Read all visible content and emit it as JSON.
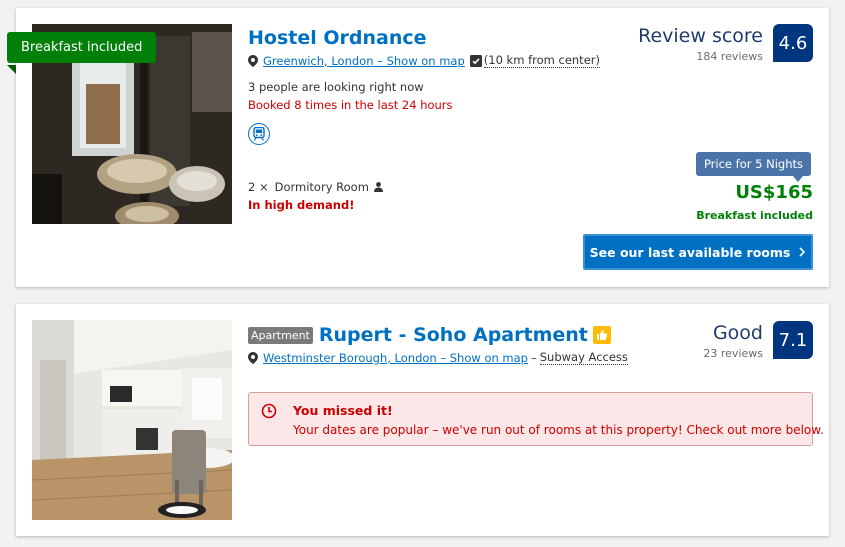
{
  "listings": [
    {
      "badge": "Breakfast included",
      "title": "Hostel Ordnance",
      "location": "Greenwich, London – Show on map",
      "distance": "(10 km from center)",
      "looking": "3 people are looking right now",
      "booked": "Booked 8 times in the last 24 hours",
      "room_count": "2 ×",
      "room_type": "Dormitory Room",
      "demand": "In high demand!",
      "score_word": "Review score",
      "reviews": "184 reviews",
      "score": "4.6",
      "price_label": "Price for 5 Nights",
      "price": "US$165",
      "price_note": "Breakfast included",
      "cta": "See our last available rooms"
    },
    {
      "type_label": "Apartment",
      "title": "Rupert - Soho Apartment",
      "location": "Westminster Borough, London – Show on map",
      "separator": "–",
      "transit": "Subway Access",
      "score_word": "Good",
      "reviews": "23 reviews",
      "score": "7.1",
      "alert_title": "You missed it!",
      "alert_text": "Your dates are popular – we've run out of rooms at this property! Check out more below."
    }
  ],
  "colors": {
    "brand_blue": "#0071c2",
    "score_navy": "#003580",
    "green": "#008009",
    "red": "#cc0000",
    "genius_yellow": "#febb02"
  },
  "icons": [
    "map-pin-icon",
    "check-square-icon",
    "train-icon",
    "person-icon",
    "chevron-right-icon",
    "clock-icon",
    "thumbs-up-icon"
  ]
}
